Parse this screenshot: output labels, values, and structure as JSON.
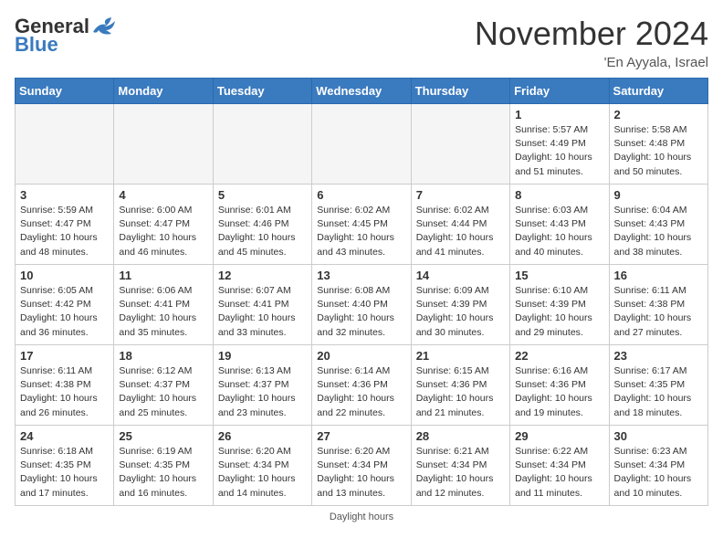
{
  "header": {
    "logo_general": "General",
    "logo_blue": "Blue",
    "month_title": "November 2024",
    "location": "'En Ayyala, Israel"
  },
  "weekdays": [
    "Sunday",
    "Monday",
    "Tuesday",
    "Wednesday",
    "Thursday",
    "Friday",
    "Saturday"
  ],
  "weeks": [
    [
      {
        "day": "",
        "sunrise": "",
        "sunset": "",
        "daylight": ""
      },
      {
        "day": "",
        "sunrise": "",
        "sunset": "",
        "daylight": ""
      },
      {
        "day": "",
        "sunrise": "",
        "sunset": "",
        "daylight": ""
      },
      {
        "day": "",
        "sunrise": "",
        "sunset": "",
        "daylight": ""
      },
      {
        "day": "",
        "sunrise": "",
        "sunset": "",
        "daylight": ""
      },
      {
        "day": "1",
        "sunrise": "Sunrise: 5:57 AM",
        "sunset": "Sunset: 4:49 PM",
        "daylight": "Daylight: 10 hours and 51 minutes."
      },
      {
        "day": "2",
        "sunrise": "Sunrise: 5:58 AM",
        "sunset": "Sunset: 4:48 PM",
        "daylight": "Daylight: 10 hours and 50 minutes."
      }
    ],
    [
      {
        "day": "3",
        "sunrise": "Sunrise: 5:59 AM",
        "sunset": "Sunset: 4:47 PM",
        "daylight": "Daylight: 10 hours and 48 minutes."
      },
      {
        "day": "4",
        "sunrise": "Sunrise: 6:00 AM",
        "sunset": "Sunset: 4:47 PM",
        "daylight": "Daylight: 10 hours and 46 minutes."
      },
      {
        "day": "5",
        "sunrise": "Sunrise: 6:01 AM",
        "sunset": "Sunset: 4:46 PM",
        "daylight": "Daylight: 10 hours and 45 minutes."
      },
      {
        "day": "6",
        "sunrise": "Sunrise: 6:02 AM",
        "sunset": "Sunset: 4:45 PM",
        "daylight": "Daylight: 10 hours and 43 minutes."
      },
      {
        "day": "7",
        "sunrise": "Sunrise: 6:02 AM",
        "sunset": "Sunset: 4:44 PM",
        "daylight": "Daylight: 10 hours and 41 minutes."
      },
      {
        "day": "8",
        "sunrise": "Sunrise: 6:03 AM",
        "sunset": "Sunset: 4:43 PM",
        "daylight": "Daylight: 10 hours and 40 minutes."
      },
      {
        "day": "9",
        "sunrise": "Sunrise: 6:04 AM",
        "sunset": "Sunset: 4:43 PM",
        "daylight": "Daylight: 10 hours and 38 minutes."
      }
    ],
    [
      {
        "day": "10",
        "sunrise": "Sunrise: 6:05 AM",
        "sunset": "Sunset: 4:42 PM",
        "daylight": "Daylight: 10 hours and 36 minutes."
      },
      {
        "day": "11",
        "sunrise": "Sunrise: 6:06 AM",
        "sunset": "Sunset: 4:41 PM",
        "daylight": "Daylight: 10 hours and 35 minutes."
      },
      {
        "day": "12",
        "sunrise": "Sunrise: 6:07 AM",
        "sunset": "Sunset: 4:41 PM",
        "daylight": "Daylight: 10 hours and 33 minutes."
      },
      {
        "day": "13",
        "sunrise": "Sunrise: 6:08 AM",
        "sunset": "Sunset: 4:40 PM",
        "daylight": "Daylight: 10 hours and 32 minutes."
      },
      {
        "day": "14",
        "sunrise": "Sunrise: 6:09 AM",
        "sunset": "Sunset: 4:39 PM",
        "daylight": "Daylight: 10 hours and 30 minutes."
      },
      {
        "day": "15",
        "sunrise": "Sunrise: 6:10 AM",
        "sunset": "Sunset: 4:39 PM",
        "daylight": "Daylight: 10 hours and 29 minutes."
      },
      {
        "day": "16",
        "sunrise": "Sunrise: 6:11 AM",
        "sunset": "Sunset: 4:38 PM",
        "daylight": "Daylight: 10 hours and 27 minutes."
      }
    ],
    [
      {
        "day": "17",
        "sunrise": "Sunrise: 6:11 AM",
        "sunset": "Sunset: 4:38 PM",
        "daylight": "Daylight: 10 hours and 26 minutes."
      },
      {
        "day": "18",
        "sunrise": "Sunrise: 6:12 AM",
        "sunset": "Sunset: 4:37 PM",
        "daylight": "Daylight: 10 hours and 25 minutes."
      },
      {
        "day": "19",
        "sunrise": "Sunrise: 6:13 AM",
        "sunset": "Sunset: 4:37 PM",
        "daylight": "Daylight: 10 hours and 23 minutes."
      },
      {
        "day": "20",
        "sunrise": "Sunrise: 6:14 AM",
        "sunset": "Sunset: 4:36 PM",
        "daylight": "Daylight: 10 hours and 22 minutes."
      },
      {
        "day": "21",
        "sunrise": "Sunrise: 6:15 AM",
        "sunset": "Sunset: 4:36 PM",
        "daylight": "Daylight: 10 hours and 21 minutes."
      },
      {
        "day": "22",
        "sunrise": "Sunrise: 6:16 AM",
        "sunset": "Sunset: 4:36 PM",
        "daylight": "Daylight: 10 hours and 19 minutes."
      },
      {
        "day": "23",
        "sunrise": "Sunrise: 6:17 AM",
        "sunset": "Sunset: 4:35 PM",
        "daylight": "Daylight: 10 hours and 18 minutes."
      }
    ],
    [
      {
        "day": "24",
        "sunrise": "Sunrise: 6:18 AM",
        "sunset": "Sunset: 4:35 PM",
        "daylight": "Daylight: 10 hours and 17 minutes."
      },
      {
        "day": "25",
        "sunrise": "Sunrise: 6:19 AM",
        "sunset": "Sunset: 4:35 PM",
        "daylight": "Daylight: 10 hours and 16 minutes."
      },
      {
        "day": "26",
        "sunrise": "Sunrise: 6:20 AM",
        "sunset": "Sunset: 4:34 PM",
        "daylight": "Daylight: 10 hours and 14 minutes."
      },
      {
        "day": "27",
        "sunrise": "Sunrise: 6:20 AM",
        "sunset": "Sunset: 4:34 PM",
        "daylight": "Daylight: 10 hours and 13 minutes."
      },
      {
        "day": "28",
        "sunrise": "Sunrise: 6:21 AM",
        "sunset": "Sunset: 4:34 PM",
        "daylight": "Daylight: 10 hours and 12 minutes."
      },
      {
        "day": "29",
        "sunrise": "Sunrise: 6:22 AM",
        "sunset": "Sunset: 4:34 PM",
        "daylight": "Daylight: 10 hours and 11 minutes."
      },
      {
        "day": "30",
        "sunrise": "Sunrise: 6:23 AM",
        "sunset": "Sunset: 4:34 PM",
        "daylight": "Daylight: 10 hours and 10 minutes."
      }
    ]
  ],
  "footer": {
    "label": "Daylight hours"
  }
}
